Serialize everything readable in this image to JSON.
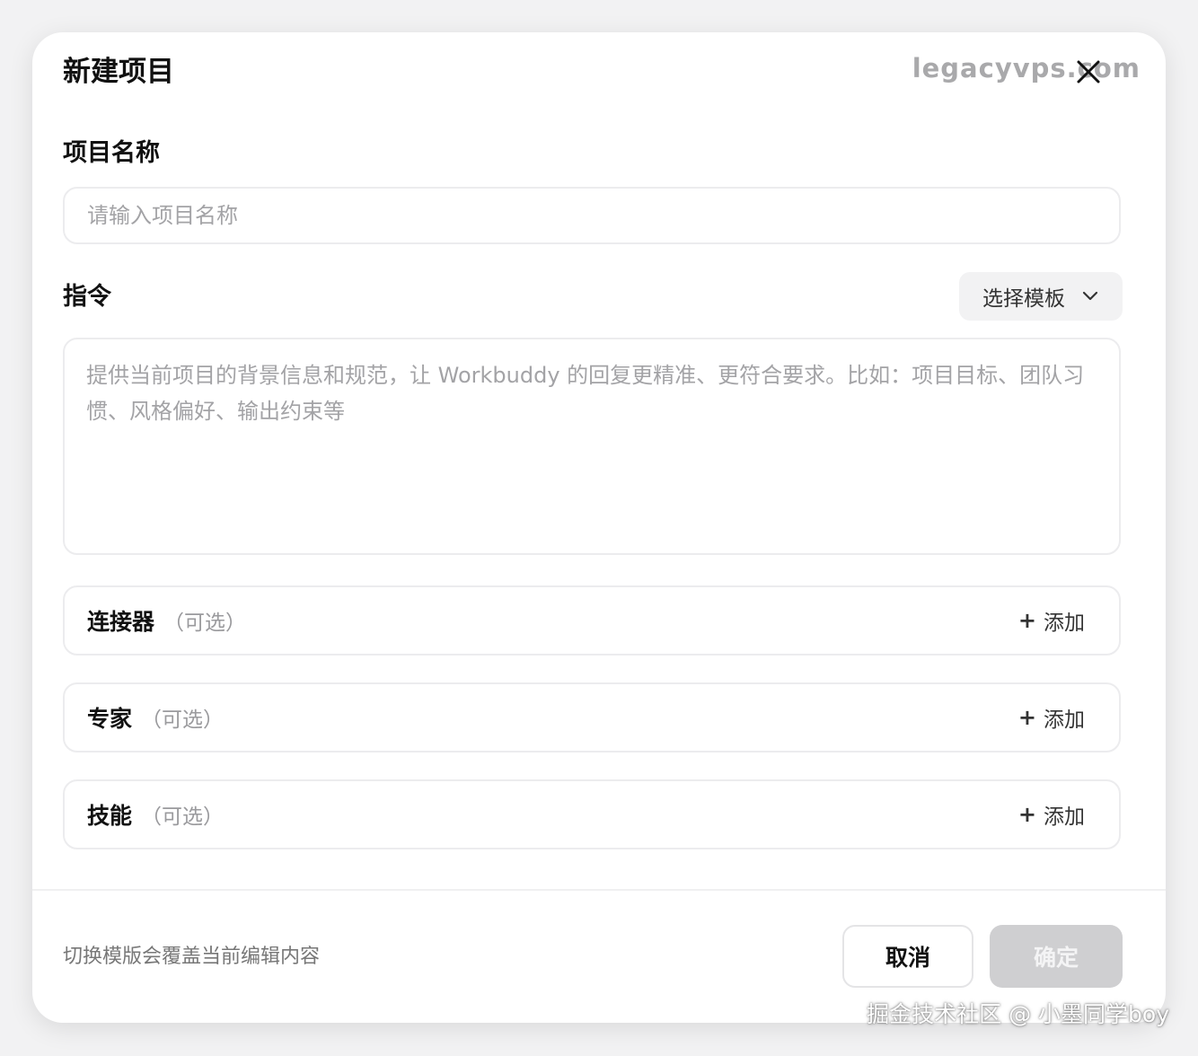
{
  "dialog": {
    "title": "新建项目",
    "watermark_top": "legacyvps.com"
  },
  "project_name": {
    "label": "项目名称",
    "placeholder": "请输入项目名称",
    "value": ""
  },
  "instruction": {
    "label": "指令",
    "template_button": "选择模板",
    "placeholder": "提供当前项目的背景信息和规范，让 Workbuddy 的回复更精准、更符合要求。比如：项目目标、团队习惯、风格偏好、输出约束等",
    "value": ""
  },
  "sections": [
    {
      "title": "连接器",
      "optional": "（可选）",
      "add_label": "添加"
    },
    {
      "title": "专家",
      "optional": "（可选）",
      "add_label": "添加"
    },
    {
      "title": "技能",
      "optional": "（可选）",
      "add_label": "添加"
    }
  ],
  "add_plus": "+",
  "footer": {
    "note": "切换模版会覆盖当前编辑内容",
    "cancel": "取消",
    "confirm": "确定"
  },
  "watermark_bottom": "掘金技术社区 @ 小墨同学boy",
  "icons": {
    "close": "close-icon",
    "dropdown": "chevron-down-icon"
  },
  "colors": {
    "confirm_disabled": "#cfcfd1",
    "border": "#ececee"
  }
}
